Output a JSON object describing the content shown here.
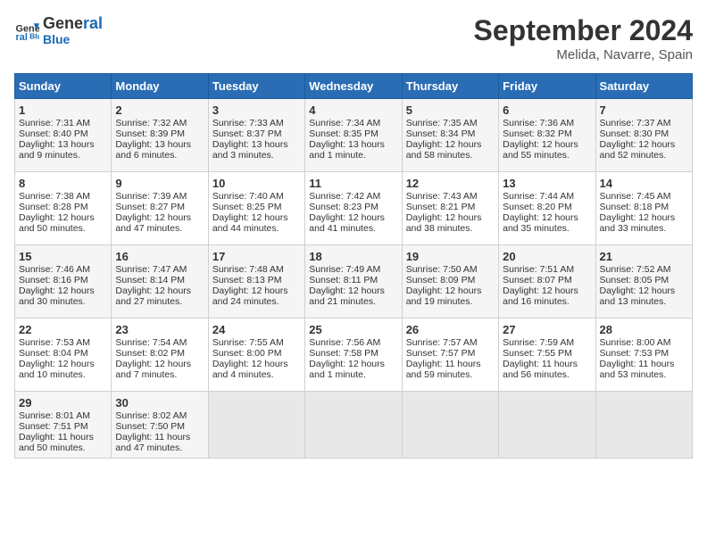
{
  "header": {
    "logo_line1": "General",
    "logo_line2": "Blue",
    "month": "September 2024",
    "location": "Melida, Navarre, Spain"
  },
  "days_of_week": [
    "Sunday",
    "Monday",
    "Tuesday",
    "Wednesday",
    "Thursday",
    "Friday",
    "Saturday"
  ],
  "weeks": [
    [
      {
        "day": "1",
        "sunrise": "Sunrise: 7:31 AM",
        "sunset": "Sunset: 8:40 PM",
        "daylight": "Daylight: 13 hours and 9 minutes."
      },
      {
        "day": "2",
        "sunrise": "Sunrise: 7:32 AM",
        "sunset": "Sunset: 8:39 PM",
        "daylight": "Daylight: 13 hours and 6 minutes."
      },
      {
        "day": "3",
        "sunrise": "Sunrise: 7:33 AM",
        "sunset": "Sunset: 8:37 PM",
        "daylight": "Daylight: 13 hours and 3 minutes."
      },
      {
        "day": "4",
        "sunrise": "Sunrise: 7:34 AM",
        "sunset": "Sunset: 8:35 PM",
        "daylight": "Daylight: 13 hours and 1 minute."
      },
      {
        "day": "5",
        "sunrise": "Sunrise: 7:35 AM",
        "sunset": "Sunset: 8:34 PM",
        "daylight": "Daylight: 12 hours and 58 minutes."
      },
      {
        "day": "6",
        "sunrise": "Sunrise: 7:36 AM",
        "sunset": "Sunset: 8:32 PM",
        "daylight": "Daylight: 12 hours and 55 minutes."
      },
      {
        "day": "7",
        "sunrise": "Sunrise: 7:37 AM",
        "sunset": "Sunset: 8:30 PM",
        "daylight": "Daylight: 12 hours and 52 minutes."
      }
    ],
    [
      {
        "day": "8",
        "sunrise": "Sunrise: 7:38 AM",
        "sunset": "Sunset: 8:28 PM",
        "daylight": "Daylight: 12 hours and 50 minutes."
      },
      {
        "day": "9",
        "sunrise": "Sunrise: 7:39 AM",
        "sunset": "Sunset: 8:27 PM",
        "daylight": "Daylight: 12 hours and 47 minutes."
      },
      {
        "day": "10",
        "sunrise": "Sunrise: 7:40 AM",
        "sunset": "Sunset: 8:25 PM",
        "daylight": "Daylight: 12 hours and 44 minutes."
      },
      {
        "day": "11",
        "sunrise": "Sunrise: 7:42 AM",
        "sunset": "Sunset: 8:23 PM",
        "daylight": "Daylight: 12 hours and 41 minutes."
      },
      {
        "day": "12",
        "sunrise": "Sunrise: 7:43 AM",
        "sunset": "Sunset: 8:21 PM",
        "daylight": "Daylight: 12 hours and 38 minutes."
      },
      {
        "day": "13",
        "sunrise": "Sunrise: 7:44 AM",
        "sunset": "Sunset: 8:20 PM",
        "daylight": "Daylight: 12 hours and 35 minutes."
      },
      {
        "day": "14",
        "sunrise": "Sunrise: 7:45 AM",
        "sunset": "Sunset: 8:18 PM",
        "daylight": "Daylight: 12 hours and 33 minutes."
      }
    ],
    [
      {
        "day": "15",
        "sunrise": "Sunrise: 7:46 AM",
        "sunset": "Sunset: 8:16 PM",
        "daylight": "Daylight: 12 hours and 30 minutes."
      },
      {
        "day": "16",
        "sunrise": "Sunrise: 7:47 AM",
        "sunset": "Sunset: 8:14 PM",
        "daylight": "Daylight: 12 hours and 27 minutes."
      },
      {
        "day": "17",
        "sunrise": "Sunrise: 7:48 AM",
        "sunset": "Sunset: 8:13 PM",
        "daylight": "Daylight: 12 hours and 24 minutes."
      },
      {
        "day": "18",
        "sunrise": "Sunrise: 7:49 AM",
        "sunset": "Sunset: 8:11 PM",
        "daylight": "Daylight: 12 hours and 21 minutes."
      },
      {
        "day": "19",
        "sunrise": "Sunrise: 7:50 AM",
        "sunset": "Sunset: 8:09 PM",
        "daylight": "Daylight: 12 hours and 19 minutes."
      },
      {
        "day": "20",
        "sunrise": "Sunrise: 7:51 AM",
        "sunset": "Sunset: 8:07 PM",
        "daylight": "Daylight: 12 hours and 16 minutes."
      },
      {
        "day": "21",
        "sunrise": "Sunrise: 7:52 AM",
        "sunset": "Sunset: 8:05 PM",
        "daylight": "Daylight: 12 hours and 13 minutes."
      }
    ],
    [
      {
        "day": "22",
        "sunrise": "Sunrise: 7:53 AM",
        "sunset": "Sunset: 8:04 PM",
        "daylight": "Daylight: 12 hours and 10 minutes."
      },
      {
        "day": "23",
        "sunrise": "Sunrise: 7:54 AM",
        "sunset": "Sunset: 8:02 PM",
        "daylight": "Daylight: 12 hours and 7 minutes."
      },
      {
        "day": "24",
        "sunrise": "Sunrise: 7:55 AM",
        "sunset": "Sunset: 8:00 PM",
        "daylight": "Daylight: 12 hours and 4 minutes."
      },
      {
        "day": "25",
        "sunrise": "Sunrise: 7:56 AM",
        "sunset": "Sunset: 7:58 PM",
        "daylight": "Daylight: 12 hours and 1 minute."
      },
      {
        "day": "26",
        "sunrise": "Sunrise: 7:57 AM",
        "sunset": "Sunset: 7:57 PM",
        "daylight": "Daylight: 11 hours and 59 minutes."
      },
      {
        "day": "27",
        "sunrise": "Sunrise: 7:59 AM",
        "sunset": "Sunset: 7:55 PM",
        "daylight": "Daylight: 11 hours and 56 minutes."
      },
      {
        "day": "28",
        "sunrise": "Sunrise: 8:00 AM",
        "sunset": "Sunset: 7:53 PM",
        "daylight": "Daylight: 11 hours and 53 minutes."
      }
    ],
    [
      {
        "day": "29",
        "sunrise": "Sunrise: 8:01 AM",
        "sunset": "Sunset: 7:51 PM",
        "daylight": "Daylight: 11 hours and 50 minutes."
      },
      {
        "day": "30",
        "sunrise": "Sunrise: 8:02 AM",
        "sunset": "Sunset: 7:50 PM",
        "daylight": "Daylight: 11 hours and 47 minutes."
      },
      null,
      null,
      null,
      null,
      null
    ]
  ]
}
